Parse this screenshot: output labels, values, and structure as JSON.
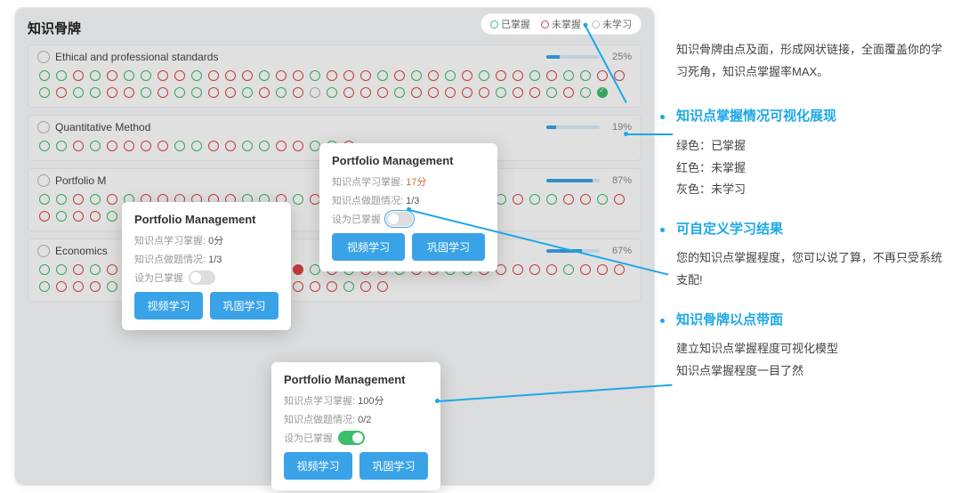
{
  "panel_title": "知识骨牌",
  "legend": {
    "mastered": "已掌握",
    "not_mastered": "未掌握",
    "not_studied": "未学习"
  },
  "sections": [
    {
      "title": "Ethical and professional standards",
      "pct": "25%",
      "fill": 25
    },
    {
      "title": "Quantitative Method",
      "pct": "19%",
      "fill": 19
    },
    {
      "title": "Portfolio M",
      "pct": "87%",
      "fill": 87
    },
    {
      "title": "Economics",
      "pct": "67%",
      "fill": 67
    }
  ],
  "popup_center": {
    "title": "Portfolio Management",
    "score_label": "知识点学习掌握:",
    "score_value": "17分",
    "exercise_label": "知识点做题情况:",
    "exercise_value": "1/3",
    "toggle_label": "设为已掌握",
    "btn_video": "视频学习",
    "btn_practice": "巩固学习"
  },
  "popup_left": {
    "title": "Portfolio Management",
    "score_label": "知识点学习掌握:",
    "score_value": "0分",
    "exercise_label": "知识点做题情况:",
    "exercise_value": "1/3",
    "toggle_label": "设为已掌握",
    "btn_video": "视频学习",
    "btn_practice": "巩固学习"
  },
  "popup_bottom": {
    "title": "Portfolio Management",
    "score_label": "知识点学习掌握:",
    "score_value": "100分",
    "exercise_label": "知识点做题情况:",
    "exercise_value": "0/2",
    "toggle_label": "设为已掌握",
    "btn_video": "视频学习",
    "btn_practice": "巩固学习"
  },
  "side": {
    "intro": "知识骨牌由点及面，形成网状链接，全面覆盖你的学习死角，知识点掌握率MAX。",
    "b1_title": "知识点掌握情况可视化展现",
    "b1_l1": "绿色：已掌握",
    "b1_l2": "红色：未掌握",
    "b1_l3": "灰色：未学习",
    "b2_title": "可自定义学习结果",
    "b2_l1": "您的知识点掌握程度，您可以说了算，不再只受系统支配!",
    "b3_title": "知识骨牌以点带面",
    "b3_l1": "建立知识点掌握程度可视化模型",
    "b3_l2": "知识点掌握程度一目了然"
  },
  "dot_rows": {
    "s0": "ggrgrggrrgrrrgrrgrrrgrgrgrgrrgrggrrgrggrrgrggrrgrgrAgrrrgrrrrrgrrgrgB",
    "s1": "ggrgrrrrggrrggrrggr",
    "s2": "ggrgrgrrrrrrggrgrrgrggrggrrgrggrrgrrgrrg",
    "s3": "ggrgrrrrrgrrgrrCgrgrrgrrggrrrrrgrrrgrrrggrrgrrrrrgrrrgrr"
  }
}
